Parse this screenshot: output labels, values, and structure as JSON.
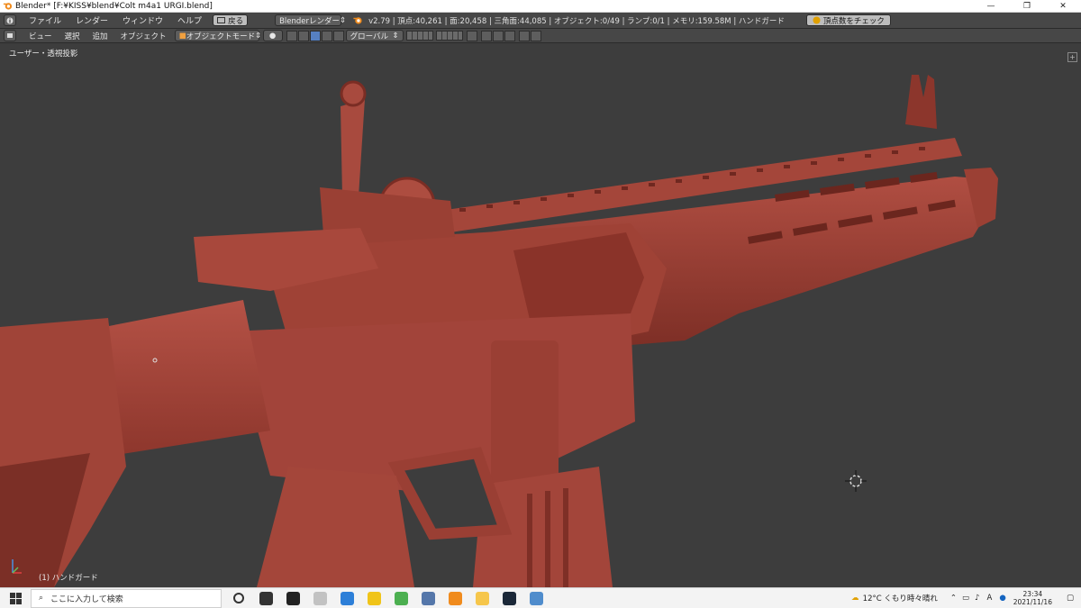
{
  "window": {
    "title": "Blender* [F:¥KISS¥blend¥Colt m4a1 URGI.blend]",
    "minimize_glyph": "—",
    "maximize_glyph": "❐",
    "close_glyph": "✕"
  },
  "info_header": {
    "menus": [
      "ファイル",
      "レンダー",
      "ウィンドウ",
      "ヘルプ"
    ],
    "back_button": "戻る",
    "render_engine": "Blenderレンダー",
    "stats": "v2.79 | 頂点:40,261 | 面:20,458 | 三角面:44,085 | オブジェクト:0/49 | ランプ:0/1 | メモリ:159.58M | ハンドガード",
    "check_button": "頂点数をチェック"
  },
  "view_header": {
    "menus": [
      "ビュー",
      "選択",
      "追加",
      "オブジェクト"
    ],
    "mode": "オブジェクトモード",
    "orientation": "グローバル"
  },
  "viewport": {
    "view_label": "ユーザー・透視投影",
    "object_label": "(1) ハンドガード",
    "background_color": "#3d3d3d",
    "model_color": "#a8463b"
  },
  "taskbar": {
    "search_placeholder": "ここに入力して検索",
    "weather": "12°C くもり時々晴れ",
    "ime": "A",
    "time": "23:34",
    "date": "2021/11/16",
    "apps": [
      {
        "name": "task-view-icon",
        "color": "#333333"
      },
      {
        "name": "taskbar-app-1-icon",
        "color": "#222222"
      },
      {
        "name": "taskbar-app-2-icon",
        "color": "#c2c2c2"
      },
      {
        "name": "taskbar-app-3-icon",
        "color": "#2d7fd8"
      },
      {
        "name": "taskbar-app-4-icon",
        "color": "#f0c419"
      },
      {
        "name": "chrome-icon",
        "color": "#4caf50"
      },
      {
        "name": "taskbar-app-6-icon",
        "color": "#5577aa"
      },
      {
        "name": "blender-icon",
        "color": "#f08b1d"
      },
      {
        "name": "file-explorer-icon",
        "color": "#f6c64b"
      },
      {
        "name": "steam-icon",
        "color": "#1b2838"
      },
      {
        "name": "taskbar-app-10-icon",
        "color": "#4f8ccc"
      }
    ]
  }
}
